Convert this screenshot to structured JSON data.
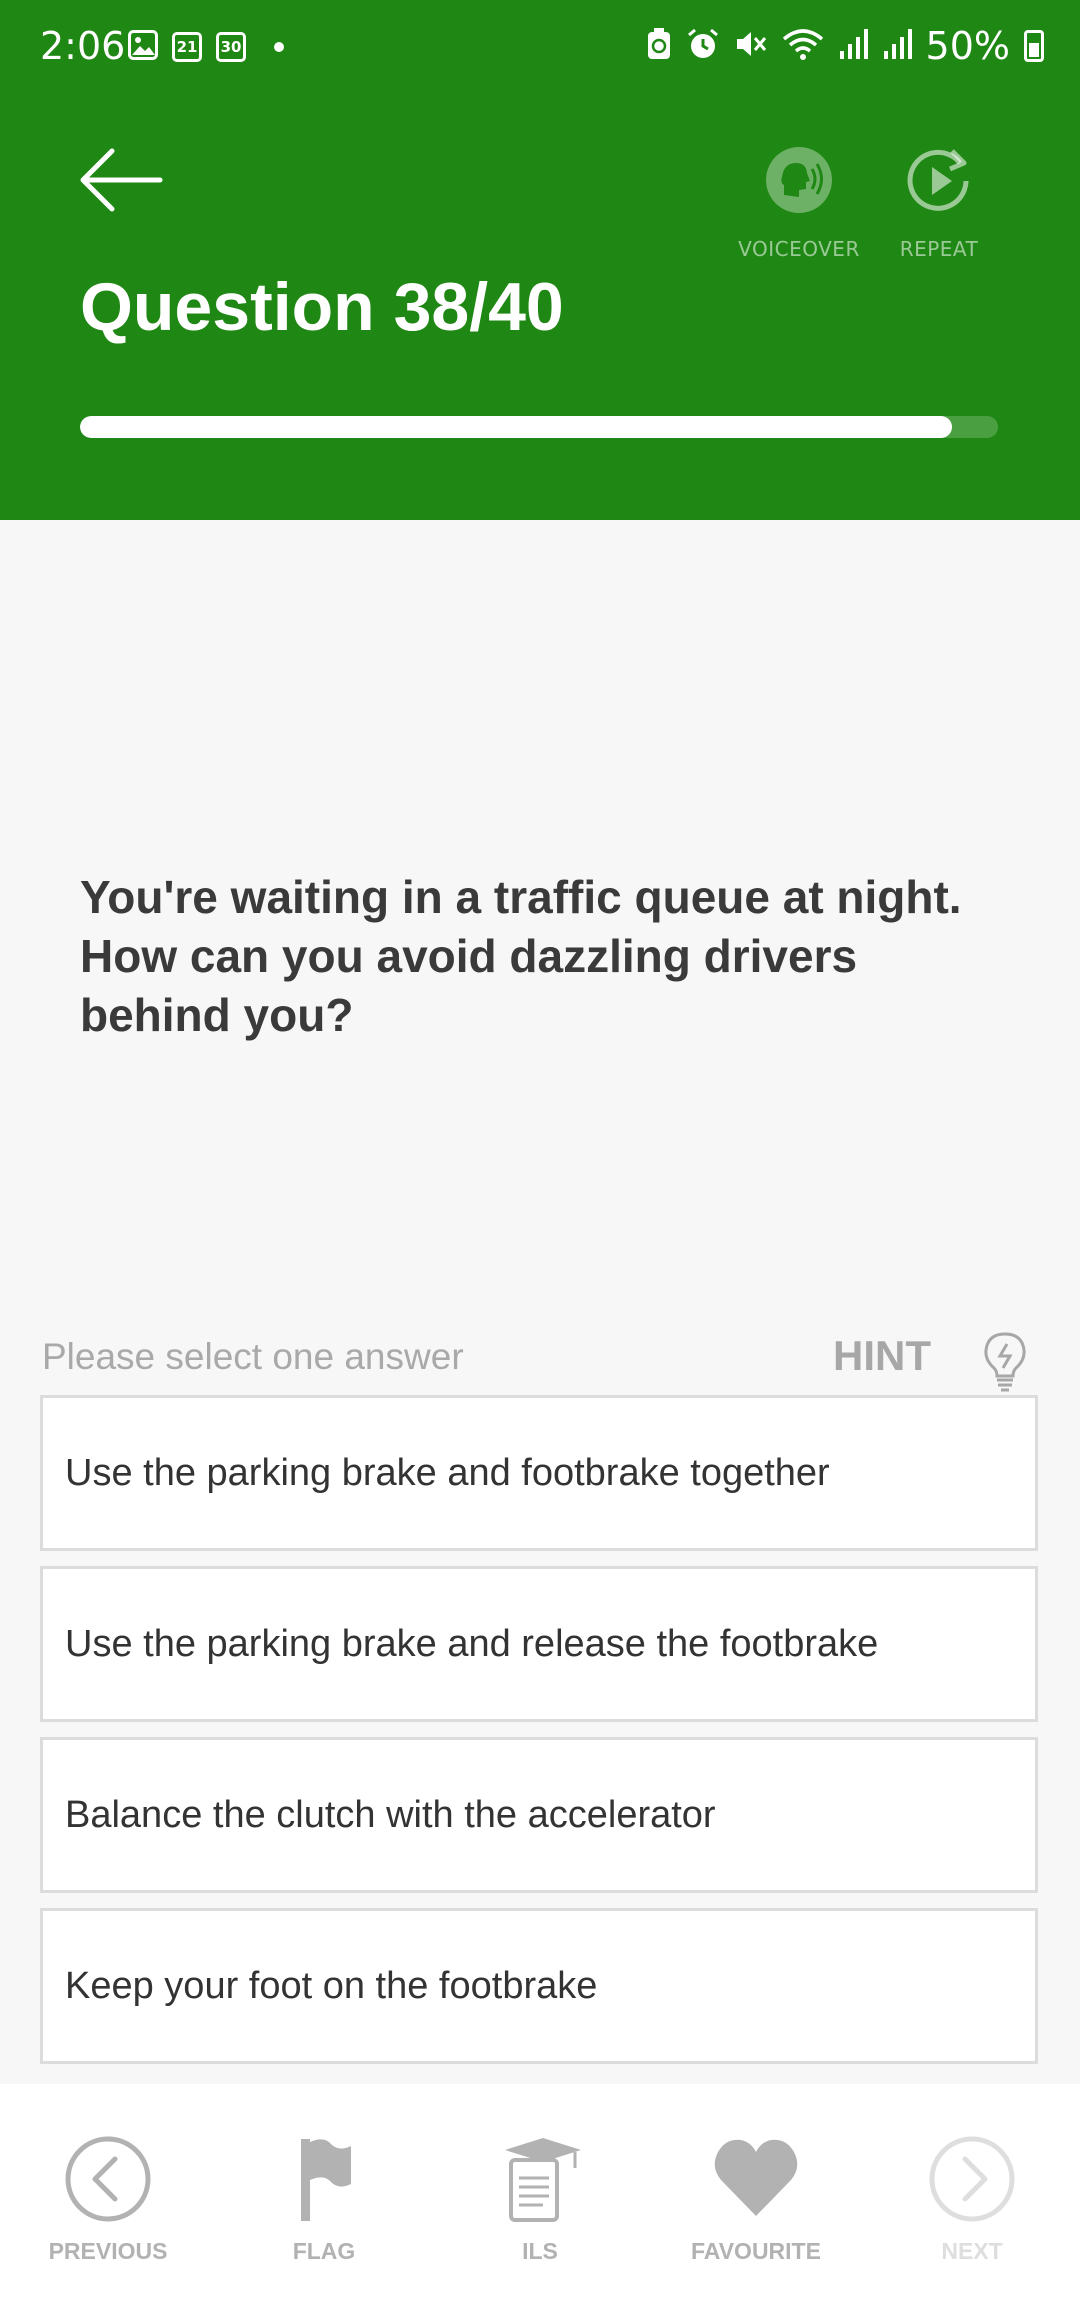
{
  "status_bar": {
    "time": "2:06",
    "calendar_day_1": "21",
    "calendar_day_2": "30",
    "battery": "50%"
  },
  "header": {
    "title": "Question 38/40",
    "voiceover_label": "VOICEOVER",
    "repeat_label": "REPEAT",
    "progress_fraction": 0.95,
    "color": "#1f8714"
  },
  "question": {
    "text": "You're waiting in a traffic queue at night. How can you avoid dazzling drivers behind you?",
    "instruction": "Please select one answer",
    "hint_label": "HINT"
  },
  "answers": [
    "Use the parking brake and footbrake together",
    "Use the parking brake and release the footbrake",
    "Balance the clutch with the accelerator",
    "Keep your foot on the footbrake"
  ],
  "bottom_nav": {
    "previous": "PREVIOUS",
    "flag": "FLAG",
    "ils": "ILS",
    "favourite": "FAVOURITE",
    "next": "NEXT"
  }
}
